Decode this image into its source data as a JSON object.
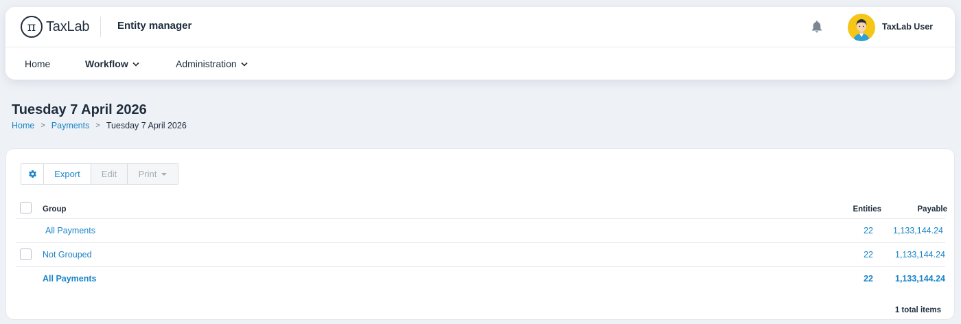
{
  "header": {
    "logo_text": "TaxLab",
    "logo_mark": "π",
    "app_title": "Entity manager",
    "notification_icon": "bell-icon",
    "user_name": "TaxLab User"
  },
  "nav": {
    "items": [
      {
        "label": "Home",
        "has_dropdown": false
      },
      {
        "label": "Workflow",
        "has_dropdown": true
      },
      {
        "label": "Administration",
        "has_dropdown": true
      }
    ]
  },
  "page": {
    "title": "Tuesday 7 April 2026",
    "breadcrumb": [
      {
        "label": "Home"
      },
      {
        "label": "Payments"
      },
      {
        "label": "Tuesday 7 April 2026"
      }
    ],
    "breadcrumb_separator": ">"
  },
  "toolbar": {
    "settings_icon": "gear-icon",
    "export_label": "Export",
    "edit_label": "Edit",
    "print_label": "Print"
  },
  "table": {
    "columns": {
      "group": "Group",
      "entities": "Entities",
      "payable": "Payable"
    },
    "rows": [
      {
        "group": "All Payments",
        "entities": "22",
        "payable": "1,133,144.24"
      },
      {
        "group": "Not Grouped",
        "entities": "22",
        "payable": "1,133,144.24"
      },
      {
        "group": "All Payments",
        "entities": "22",
        "payable": "1,133,144.24"
      }
    ],
    "footer": "1 total items"
  },
  "colors": {
    "accent": "#1a84c7",
    "text": "#1f2d3d",
    "background": "#eef1f6",
    "avatar_bg": "#f5c517"
  }
}
